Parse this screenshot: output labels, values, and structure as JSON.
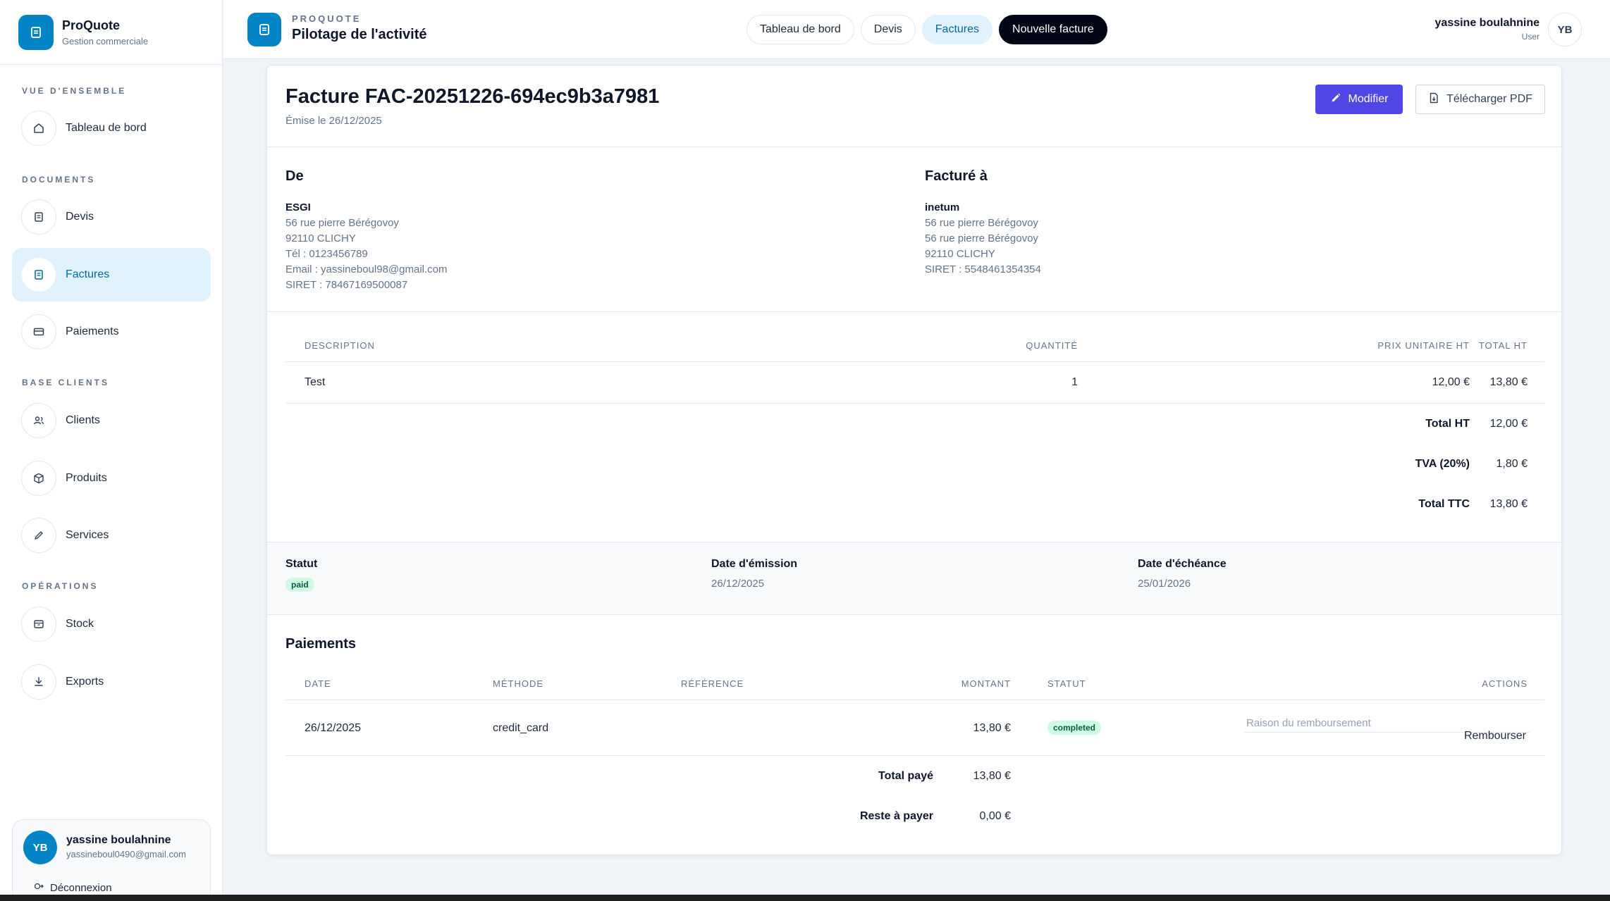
{
  "brand": {
    "name": "ProQuote",
    "subtitle": "Gestion commerciale"
  },
  "sidebar": {
    "sections": [
      {
        "title": "VUE D'ENSEMBLE"
      },
      {
        "title": "DOCUMENTS"
      },
      {
        "title": "BASE CLIENTS"
      },
      {
        "title": "OPÉRATIONS"
      }
    ],
    "items": [
      {
        "label": "Tableau de bord",
        "icon": "home-icon"
      },
      {
        "label": "Devis",
        "icon": "document-icon"
      },
      {
        "label": "Factures",
        "icon": "document-icon",
        "active": true
      },
      {
        "label": "Paiements",
        "icon": "credit-card-icon"
      },
      {
        "label": "Clients",
        "icon": "users-icon"
      },
      {
        "label": "Produits",
        "icon": "box-icon"
      },
      {
        "label": "Services",
        "icon": "pencil-icon"
      },
      {
        "label": "Stock",
        "icon": "archive-icon"
      },
      {
        "label": "Exports",
        "icon": "download-icon"
      }
    ],
    "user": {
      "initials": "YB",
      "name": "yassine boulahnine",
      "email": "yassineboul0490@gmail.com",
      "logout": "Déconnexion"
    }
  },
  "topbar": {
    "kicker": "PROQUOTE",
    "title": "Pilotage de l'activité",
    "nav": [
      "Tableau de bord",
      "Devis",
      "Factures",
      "Nouvelle facture"
    ],
    "user_name": "yassine boulahnine",
    "user_role": "User",
    "user_initials": "YB"
  },
  "invoice": {
    "title": "Facture FAC-20251226-694ec9b3a7981",
    "issued": "Émise le 26/12/2025",
    "edit_label": "Modifier",
    "pdf_label": "Télécharger PDF",
    "from": {
      "heading": "De",
      "name": "ESGI",
      "lines": [
        "56 rue pierre Bérégovoy",
        "92110 CLICHY",
        "Tél : 0123456789",
        "Email : yassineboul98@gmail.com",
        "SIRET : 78467169500087"
      ]
    },
    "to": {
      "heading": "Facturé à",
      "name": "inetum",
      "lines": [
        "56 rue pierre Bérégovoy",
        "56 rue pierre Bérégovoy",
        "92110 CLICHY",
        "SIRET : 5548461354354"
      ]
    },
    "items_headers": [
      "DESCRIPTION",
      "QUANTITÉ",
      "PRIX UNITAIRE HT",
      "TOTAL HT"
    ],
    "items": [
      {
        "description": "Test",
        "quantity": "1",
        "unit_price": "12,00 €",
        "total": "13,80 €"
      }
    ],
    "totals": [
      {
        "label": "Total HT",
        "value": "12,00 €"
      },
      {
        "label": "TVA (20%)",
        "value": "1,80 €"
      },
      {
        "label": "Total TTC",
        "value": "13,80 €"
      }
    ],
    "status": {
      "status_label": "Statut",
      "status_value": "paid",
      "issue_label": "Date d'émission",
      "issue_value": "26/12/2025",
      "due_label": "Date d'échéance",
      "due_value": "25/01/2026"
    },
    "payments": {
      "title": "Paiements",
      "headers": [
        "DATE",
        "MÉTHODE",
        "RÉFÉRENCE",
        "MONTANT",
        "STATUT",
        "ACTIONS"
      ],
      "rows": [
        {
          "date": "26/12/2025",
          "method": "credit_card",
          "reference": "",
          "amount": "13,80 €",
          "status": "completed"
        }
      ],
      "refund_placeholder": "Raison du remboursement",
      "refund_label": "Rembourser",
      "total_paid_label": "Total payé",
      "total_paid": "13,80 €",
      "remaining_label": "Reste à payer",
      "remaining": "0,00 €"
    }
  },
  "colors": {
    "accent": "#0284c7",
    "primary_button": "#4f46e5",
    "active_nav_bg": "#e0f2fe",
    "success_badge": "#d1fae5"
  }
}
